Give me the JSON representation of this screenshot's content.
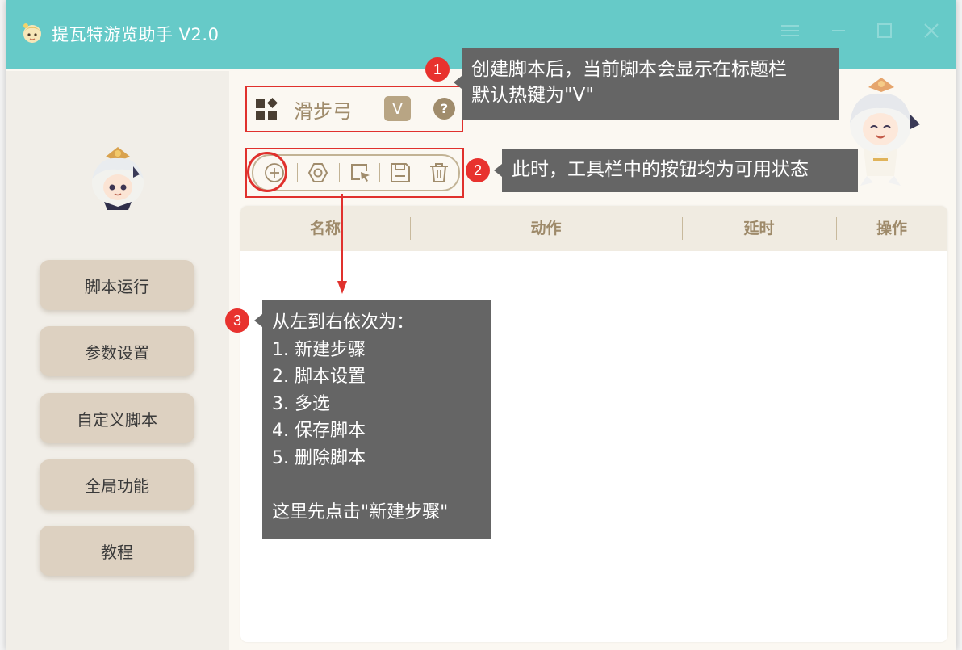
{
  "window": {
    "title": "提瓦特游览助手 V2.0",
    "controls": [
      "menu-icon",
      "minimize-icon",
      "maximize-icon",
      "close-icon"
    ]
  },
  "sidebar": {
    "items": [
      {
        "label": "脚本运行"
      },
      {
        "label": "参数设置"
      },
      {
        "label": "自定义脚本"
      },
      {
        "label": "全局功能"
      },
      {
        "label": "教程"
      }
    ]
  },
  "script": {
    "name": "滑步弓",
    "hotkey": "V",
    "help": "?"
  },
  "toolbar": {
    "buttons": [
      "add-step-icon",
      "script-settings-icon",
      "multi-select-icon",
      "save-icon",
      "delete-icon"
    ]
  },
  "table": {
    "columns": [
      "名称",
      "动作",
      "延时",
      "操作"
    ],
    "rows": []
  },
  "annotations": {
    "step1": {
      "badge": "1",
      "lines": [
        "创建脚本后，当前脚本会显示在标题栏",
        "默认热键为\"V\""
      ]
    },
    "step2": {
      "badge": "2",
      "lines": [
        "此时，工具栏中的按钮均为可用状态"
      ]
    },
    "step3": {
      "badge": "3",
      "lines": [
        "从左到右依次为：",
        "1. 新建步骤",
        "2. 脚本设置",
        "3. 多选",
        "4. 保存脚本",
        "5. 删除脚本",
        "",
        "这里先点击\"新建步骤\""
      ]
    }
  },
  "colors": {
    "titlebar": "#66cac8",
    "accent": "#a08c6c",
    "sidebar_button": "#ddd1c1",
    "highlight": "#e0312d",
    "callout": "#656565"
  }
}
